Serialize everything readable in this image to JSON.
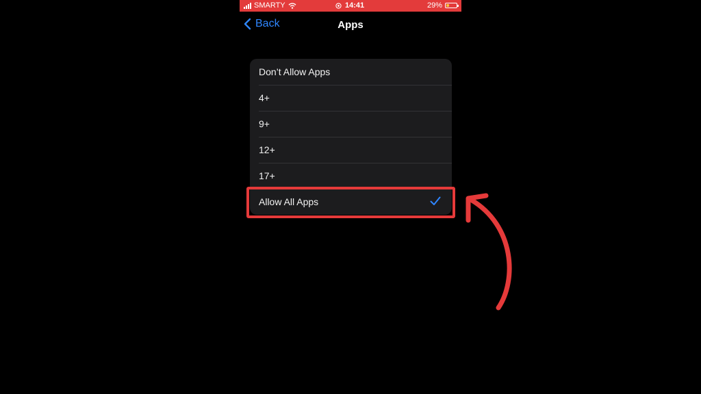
{
  "status_bar": {
    "carrier": "SMARTY",
    "time": "14:41",
    "battery_percent": "29%",
    "battery_level": 0.29,
    "background": "#e33b3b"
  },
  "nav": {
    "back_label": "Back",
    "title": "Apps",
    "accent": "#2f86ff"
  },
  "options": [
    {
      "label": "Don’t Allow Apps",
      "selected": false
    },
    {
      "label": "4+",
      "selected": false
    },
    {
      "label": "9+",
      "selected": false
    },
    {
      "label": "12+",
      "selected": false
    },
    {
      "label": "17+",
      "selected": false
    },
    {
      "label": "Allow All Apps",
      "selected": true
    }
  ],
  "icons": {
    "back": "chevron-left-icon",
    "check": "checkmark-icon",
    "wifi": "wifi-icon",
    "signal": "signal-icon",
    "battery": "battery-icon",
    "orientation_lock": "orientation-lock-icon",
    "arrow": "curved-arrow-icon"
  },
  "annotation_color": "#e53a3a"
}
